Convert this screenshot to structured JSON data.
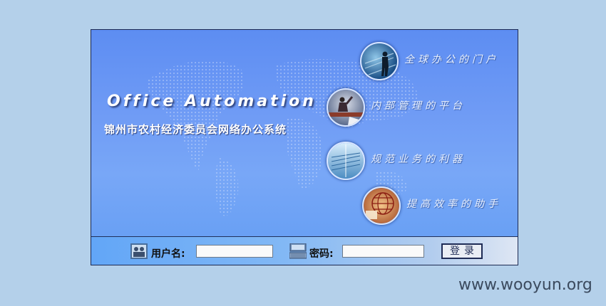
{
  "banner": {
    "title": "Office Automation",
    "subtitle": "锦州市农村经济委员会网络办公系统",
    "features": [
      {
        "slogan": "全球办公的门户",
        "image": "businessman-silhouette"
      },
      {
        "slogan": "内部管理的平台",
        "image": "worker-on-beam"
      },
      {
        "slogan": "规范业务的利器",
        "image": "glass-building"
      },
      {
        "slogan": "提高效率的助手",
        "image": "globe-grid"
      }
    ]
  },
  "login": {
    "username_label": "用户名:",
    "username_value": "",
    "password_label": "密码:",
    "password_value": "",
    "submit_label": "登录"
  },
  "watermark": "www.wooyun.org",
  "colors": {
    "page_background": "#b4d0ea",
    "banner_blue": "#6f9bf5",
    "border": "#1d2a52"
  }
}
